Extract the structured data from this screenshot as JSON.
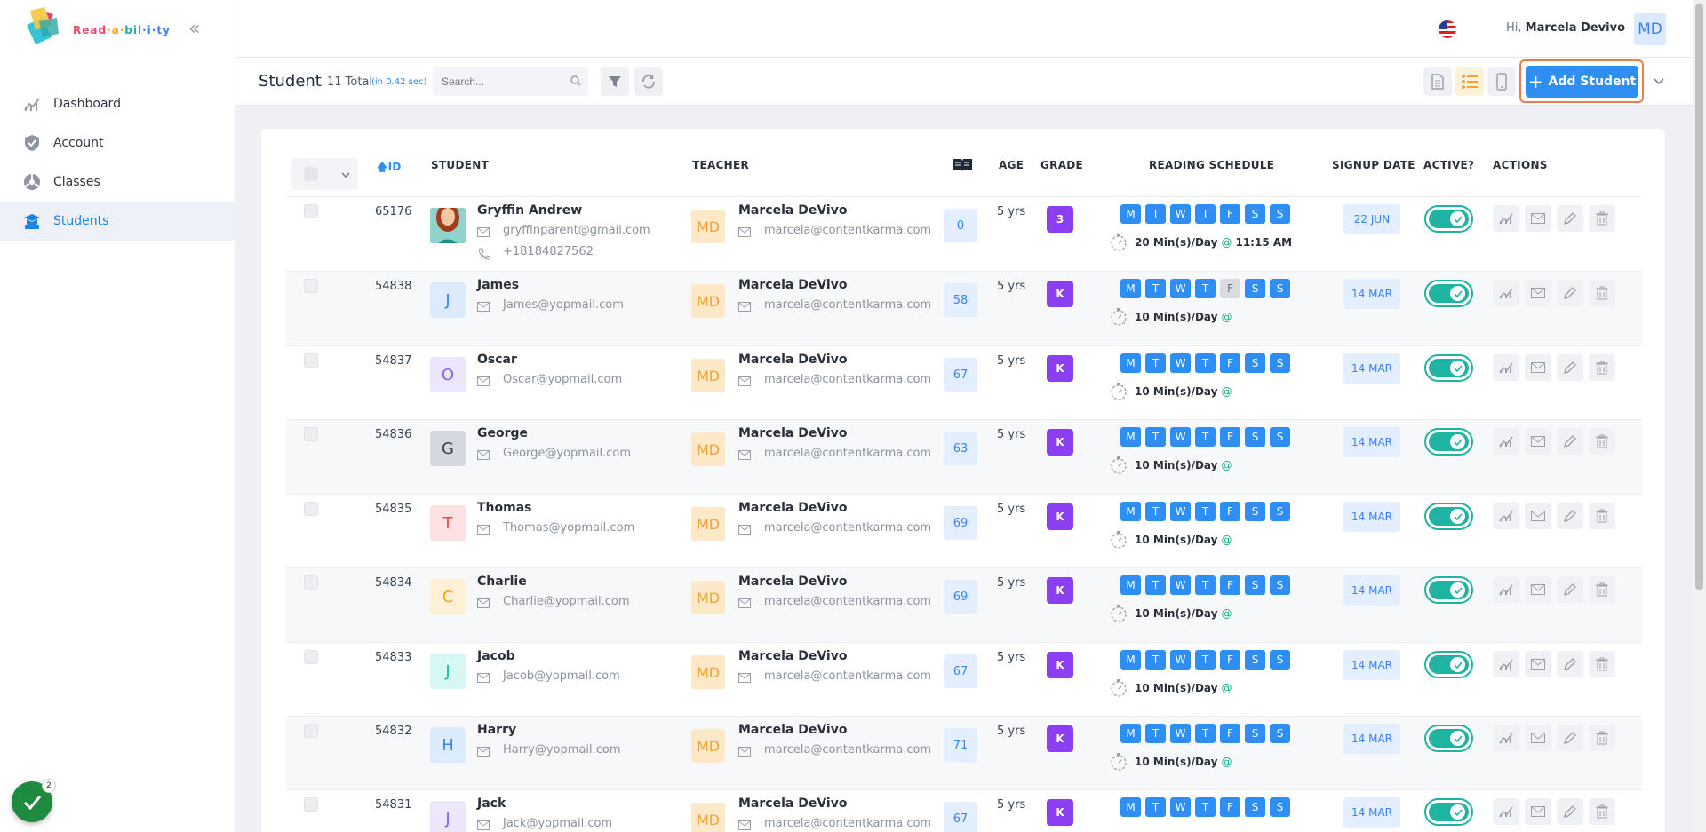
{
  "app": {
    "logo_text": "Read·a·bil·i·ty"
  },
  "sidebar": {
    "items": [
      {
        "label": "Dashboard",
        "icon": "chart-line-icon"
      },
      {
        "label": "Account",
        "icon": "shield-icon"
      },
      {
        "label": "Classes",
        "icon": "classes-icon"
      },
      {
        "label": "Students",
        "icon": "student-cap-icon",
        "active": true
      }
    ],
    "notification_count": "2"
  },
  "header": {
    "greeting": "Hi,",
    "user_name": "Marcela Devivo",
    "user_initials": "MD"
  },
  "toolbar": {
    "title": "Student",
    "total": "11 Total",
    "time": "(in 0.42 sec)",
    "search_placeholder": "Search...",
    "add_label": "Add Student"
  },
  "table": {
    "columns": {
      "id": "ID",
      "student": "STUDENT",
      "teacher": "TEACHER",
      "age": "AGE",
      "grade": "GRADE",
      "schedule": "READING SCHEDULE",
      "signup": "SIGNUP DATE",
      "active": "ACTIVE?",
      "actions": "ACTIONS"
    },
    "day_letters": [
      "M",
      "T",
      "W",
      "T",
      "F",
      "S",
      "S"
    ],
    "rows": [
      {
        "id": "65176",
        "initial": "",
        "name": "Gryffin Andrew",
        "email": "gryffinparent@gmail.com",
        "phone": "+18184827562",
        "teacher_initials": "MD",
        "teacher": "Marcela DeVivo",
        "teacher_email": "marcela@contentkarma.com",
        "reading_level": "0",
        "age": "5 yrs",
        "grade": "3",
        "schedule": "20 Min(s)/Day",
        "at": "@",
        "time": "11:15 AM",
        "signup": "22 JUN",
        "off_day": -1
      },
      {
        "id": "54838",
        "initial": "J",
        "name": "James",
        "email": "James@yopmail.com",
        "teacher_initials": "MD",
        "teacher": "Marcela DeVivo",
        "teacher_email": "marcela@contentkarma.com",
        "reading_level": "58",
        "age": "5 yrs",
        "grade": "K",
        "schedule": "10 Min(s)/Day",
        "at": "@",
        "time": "",
        "signup": "14 MAR",
        "off_day": 4
      },
      {
        "id": "54837",
        "initial": "O",
        "name": "Oscar",
        "email": "Oscar@yopmail.com",
        "teacher_initials": "MD",
        "teacher": "Marcela DeVivo",
        "teacher_email": "marcela@contentkarma.com",
        "reading_level": "67",
        "age": "5 yrs",
        "grade": "K",
        "schedule": "10 Min(s)/Day",
        "at": "@",
        "time": "",
        "signup": "14 MAR",
        "off_day": -1
      },
      {
        "id": "54836",
        "initial": "G",
        "name": "George",
        "email": "George@yopmail.com",
        "teacher_initials": "MD",
        "teacher": "Marcela DeVivo",
        "teacher_email": "marcela@contentkarma.com",
        "reading_level": "63",
        "age": "5 yrs",
        "grade": "K",
        "schedule": "10 Min(s)/Day",
        "at": "@",
        "time": "",
        "signup": "14 MAR",
        "off_day": -1
      },
      {
        "id": "54835",
        "initial": "T",
        "name": "Thomas",
        "email": "Thomas@yopmail.com",
        "teacher_initials": "MD",
        "teacher": "Marcela DeVivo",
        "teacher_email": "marcela@contentkarma.com",
        "reading_level": "69",
        "age": "5 yrs",
        "grade": "K",
        "schedule": "10 Min(s)/Day",
        "at": "@",
        "time": "",
        "signup": "14 MAR",
        "off_day": -1
      },
      {
        "id": "54834",
        "initial": "C",
        "name": "Charlie",
        "email": "Charlie@yopmail.com",
        "teacher_initials": "MD",
        "teacher": "Marcela DeVivo",
        "teacher_email": "marcela@contentkarma.com",
        "reading_level": "69",
        "age": "5 yrs",
        "grade": "K",
        "schedule": "10 Min(s)/Day",
        "at": "@",
        "time": "",
        "signup": "14 MAR",
        "off_day": -1
      },
      {
        "id": "54833",
        "initial": "J",
        "name": "Jacob",
        "email": "Jacob@yopmail.com",
        "teacher_initials": "MD",
        "teacher": "Marcela DeVivo",
        "teacher_email": "marcela@contentkarma.com",
        "reading_level": "67",
        "age": "5 yrs",
        "grade": "K",
        "schedule": "10 Min(s)/Day",
        "at": "@",
        "time": "",
        "signup": "14 MAR",
        "off_day": -1
      },
      {
        "id": "54832",
        "initial": "H",
        "name": "Harry",
        "email": "Harry@yopmail.com",
        "teacher_initials": "MD",
        "teacher": "Marcela DeVivo",
        "teacher_email": "marcela@contentkarma.com",
        "reading_level": "71",
        "age": "5 yrs",
        "grade": "K",
        "schedule": "10 Min(s)/Day",
        "at": "@",
        "time": "",
        "signup": "14 MAR",
        "off_day": -1
      },
      {
        "id": "54831",
        "initial": "J",
        "name": "Jack",
        "email": "Jack@yopmail.com",
        "teacher_initials": "MD",
        "teacher": "Marcela DeVivo",
        "teacher_email": "marcela@contentkarma.com",
        "reading_level": "67",
        "age": "5 yrs",
        "grade": "K",
        "schedule": "",
        "at": "",
        "time": "",
        "signup": "14 MAR",
        "off_day": -1
      }
    ]
  },
  "colors": {
    "primary": "#2f8ef2",
    "grade": "#8b3ff0",
    "toggle": "#1fb4a1",
    "highlight": "#f07a4a"
  },
  "avatar_colors": [
    [
      "#dcebff",
      "#3b82f6"
    ],
    [
      "#ede6ff",
      "#8b5cf6"
    ],
    [
      "#d6d8df",
      "#3a3f4a"
    ],
    [
      "#ffe0e3",
      "#e5484d"
    ],
    [
      "#fff0d6",
      "#f5a524"
    ],
    [
      "#d6f7f3",
      "#14b8a6"
    ],
    [
      "#dcebff",
      "#3b82f6"
    ],
    [
      "#ede6ff",
      "#8b5cf6"
    ]
  ]
}
